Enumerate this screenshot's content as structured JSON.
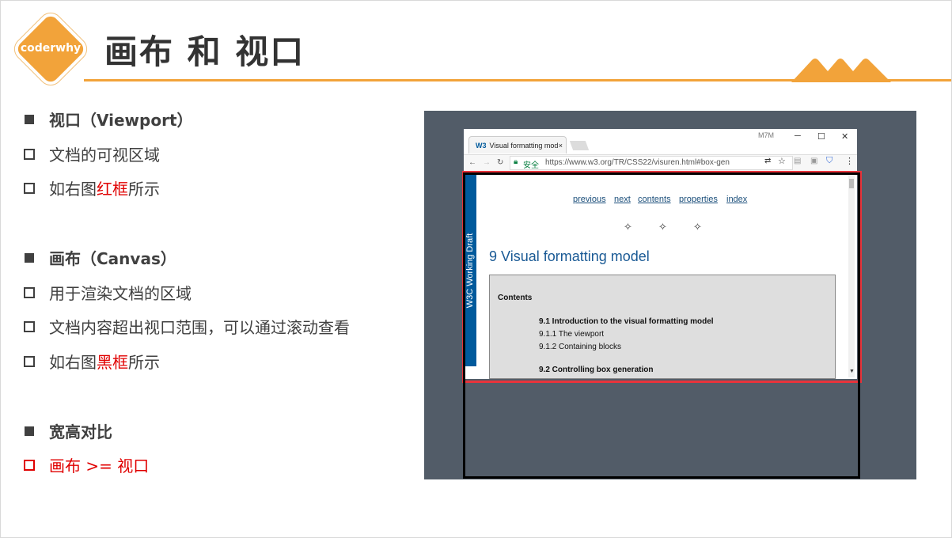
{
  "header": {
    "logo_text": "coderwhy",
    "title": "画布 和 视口",
    "accent_color": "#f2a33a"
  },
  "bullets": [
    {
      "type": "heading",
      "text": "视口（Viewport）"
    },
    {
      "type": "sub",
      "text": "文档的可视区域"
    },
    {
      "type": "sub",
      "text_before": "如右图",
      "text_red": "红框",
      "text_after": "所示"
    },
    {
      "type": "heading",
      "text": "画布（Canvas）"
    },
    {
      "type": "sub",
      "text": "用于渲染文档的区域"
    },
    {
      "type": "sub",
      "text": "文档内容超出视口范围，可以通过滚动查看"
    },
    {
      "type": "sub",
      "text_before": "如右图",
      "text_red": "黑框",
      "text_after": "所示"
    },
    {
      "type": "heading",
      "text": "宽高对比"
    },
    {
      "type": "sub-red",
      "text": "画布 >= 视口"
    }
  ],
  "figure": {
    "tab_label": "Visual formatting mod",
    "tab_close": "×",
    "secure_label": "安全",
    "url": "https://www.w3.org/TR/CSS22/visuren.html#box-gen",
    "user_label": "M7M",
    "side_label": "W3C Working Draft",
    "nav_links": [
      "previous",
      "next",
      "contents",
      "properties",
      "index"
    ],
    "page_title": "9 Visual formatting model",
    "contents_heading": "Contents",
    "toc": [
      {
        "text": "9.1 Introduction to the visual formatting model",
        "bold": true
      },
      {
        "text": "9.1.1 The viewport",
        "bold": false
      },
      {
        "text": "9.1.2 Containing blocks",
        "bold": false
      },
      {
        "text": "9.2 Controlling box generation",
        "bold": true
      }
    ],
    "viewport_frame_color": "#e8333b",
    "canvas_frame_color": "#000000"
  }
}
